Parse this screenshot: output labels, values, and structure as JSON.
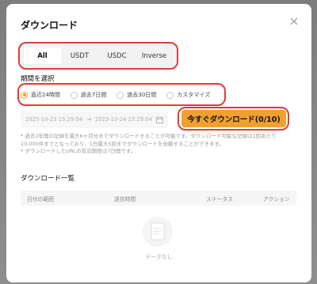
{
  "modal": {
    "title": "ダウンロード"
  },
  "tabs": [
    {
      "label": "All",
      "active": true
    },
    {
      "label": "USDT",
      "active": false
    },
    {
      "label": "USDC",
      "active": false
    },
    {
      "label": "Inverse",
      "active": false
    }
  ],
  "period": {
    "label": "期間を選択",
    "options": [
      {
        "label": "直近24時間",
        "selected": true
      },
      {
        "label": "過去7日間",
        "selected": false
      },
      {
        "label": "過去30日間",
        "selected": false
      },
      {
        "label": "カスタマイズ",
        "selected": false
      }
    ]
  },
  "date_range": {
    "start": "2025-10-23 15:29:04",
    "arrow": "→",
    "end": "2025-10-24 15:29:04"
  },
  "download_button": {
    "label": "今すぐダウンロード(0/10)"
  },
  "notes": [
    "* 過去2年間の記録を最大6ヶ月分までダウンロードすることが可能です。ダウンロード可能な記録は1回あたり",
    "10,000件までとなっており、1日最大5回までダウンロードを依頼することができます。",
    "* ダウンロードしたURLの有効期限は7日間です。"
  ],
  "download_list": {
    "title": "ダウンロード一覧",
    "columns": [
      "日付の範囲",
      "送信時間",
      "ステータス",
      "アクション"
    ],
    "empty_text": "データなし"
  },
  "colors": {
    "accent": "#f0a030",
    "highlight_ring": "#e03a3a"
  }
}
